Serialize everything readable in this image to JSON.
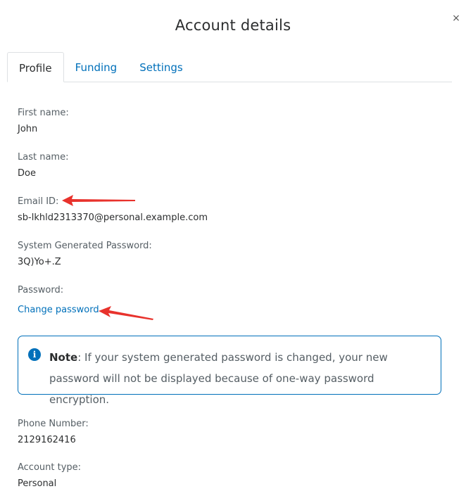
{
  "dialog": {
    "title": "Account details",
    "close_label": "×"
  },
  "tabs": [
    {
      "label": "Profile",
      "active": true
    },
    {
      "label": "Funding",
      "active": false
    },
    {
      "label": "Settings",
      "active": false
    }
  ],
  "profile": {
    "first_name_label": "First name:",
    "first_name_value": "John",
    "last_name_label": "Last name:",
    "last_name_value": "Doe",
    "email_label": "Email ID:",
    "email_value": "sb-lkhld2313370@personal.example.com",
    "sys_password_label": "System Generated Password:",
    "sys_password_value": "3Q)Yo+.Z",
    "password_label": "Password:",
    "change_password_link": "Change password",
    "note_title": "Note",
    "note_text": ": If your system generated password is changed, your new password will not be displayed because of one-way password encryption.",
    "phone_label": "Phone Number:",
    "phone_value": "2129162416",
    "account_type_label": "Account type:",
    "account_type_value": "Personal"
  },
  "colors": {
    "link": "#0070ba",
    "annotation_arrow": "#e8322c",
    "text": "#2c2e2f",
    "label": "#555e64"
  }
}
